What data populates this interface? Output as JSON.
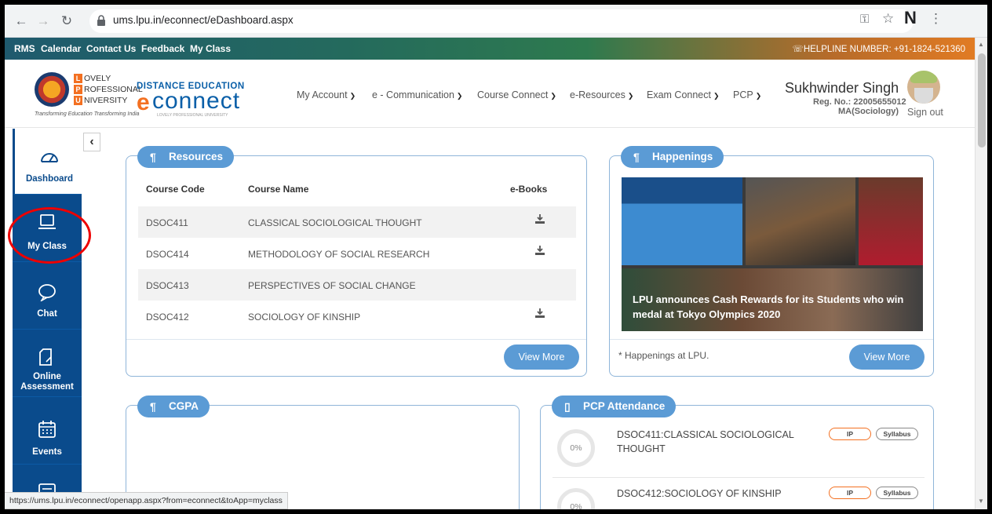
{
  "browser": {
    "url": "ums.lpu.in/econnect/eDashboard.aspx",
    "profile_initial": "N",
    "status_url": "https://ums.lpu.in/econnect/openapp.aspx?from=econnect&toApp=myclass"
  },
  "top_links": [
    "RMS",
    "Calendar",
    "Contact Us",
    "Feedback",
    "My Class"
  ],
  "helpline": "☏HELPLINE NUMBER: +91-1824-521360",
  "logo": {
    "letters": [
      "L",
      "P",
      "U"
    ],
    "words": [
      "OVELY",
      "ROFESSIONAL",
      "NIVERSITY"
    ],
    "tagline": "Transforming Education Transforming India",
    "de_title": "DISTANCE EDUCATION",
    "econnect_e": "e",
    "econnect_word": "connect",
    "econnect_sub": "LOVELY PROFESSIONAL UNIVERSITY"
  },
  "menu": [
    "My Account",
    "e - Communication",
    "Course Connect",
    "e-Resources",
    "Exam Connect",
    "PCP"
  ],
  "user": {
    "name": "Sukhwinder Singh",
    "reg_no": "Reg. No.: 22005655012",
    "programme": "MA(Sociology)",
    "sign_out": "Sign out"
  },
  "sidebar": {
    "items": [
      {
        "label": "Dashboard",
        "icon": "dashboard-icon"
      },
      {
        "label": "My Class",
        "icon": "laptop-icon"
      },
      {
        "label": "Chat",
        "icon": "chat-icon"
      },
      {
        "label": "Online Assessment",
        "icon": "assessment-icon"
      },
      {
        "label": "Events",
        "icon": "calendar-icon"
      }
    ],
    "collapse": "‹"
  },
  "resources": {
    "title": "Resources",
    "headers": [
      "Course Code",
      "Course Name",
      "e-Books"
    ],
    "rows": [
      {
        "code": "DSOC411",
        "name": "CLASSICAL SOCIOLOGICAL THOUGHT",
        "ebook": true
      },
      {
        "code": "DSOC414",
        "name": "METHODOLOGY OF SOCIAL RESEARCH",
        "ebook": true
      },
      {
        "code": "DSOC413",
        "name": "PERSPECTIVES OF SOCIAL CHANGE",
        "ebook": false
      },
      {
        "code": "DSOC412",
        "name": "SOCIOLOGY OF KINSHIP",
        "ebook": true
      }
    ],
    "view_more": "View More"
  },
  "happenings": {
    "title": "Happenings",
    "caption": "LPU announces Cash Rewards for its Students who win medal at Tokyo Olympics 2020",
    "note": "* Happenings at LPU.",
    "view_more": "View More"
  },
  "cgpa": {
    "title": "CGPA"
  },
  "pcp": {
    "title": "PCP Attendance",
    "rows": [
      {
        "course": "DSOC411:CLASSICAL SOCIOLOGICAL THOUGHT",
        "percent": "0%",
        "tag1": "IP",
        "tag2": "Syllabus"
      },
      {
        "course": "DSOC412:SOCIOLOGY OF KINSHIP",
        "percent": "0%",
        "tag1": "IP",
        "tag2": "Syllabus"
      }
    ]
  },
  "colors": {
    "sidebar": "#0a4b8c",
    "accent": "#5b9bd5",
    "orange": "#f37021",
    "highlight_ring": "#e00000"
  }
}
